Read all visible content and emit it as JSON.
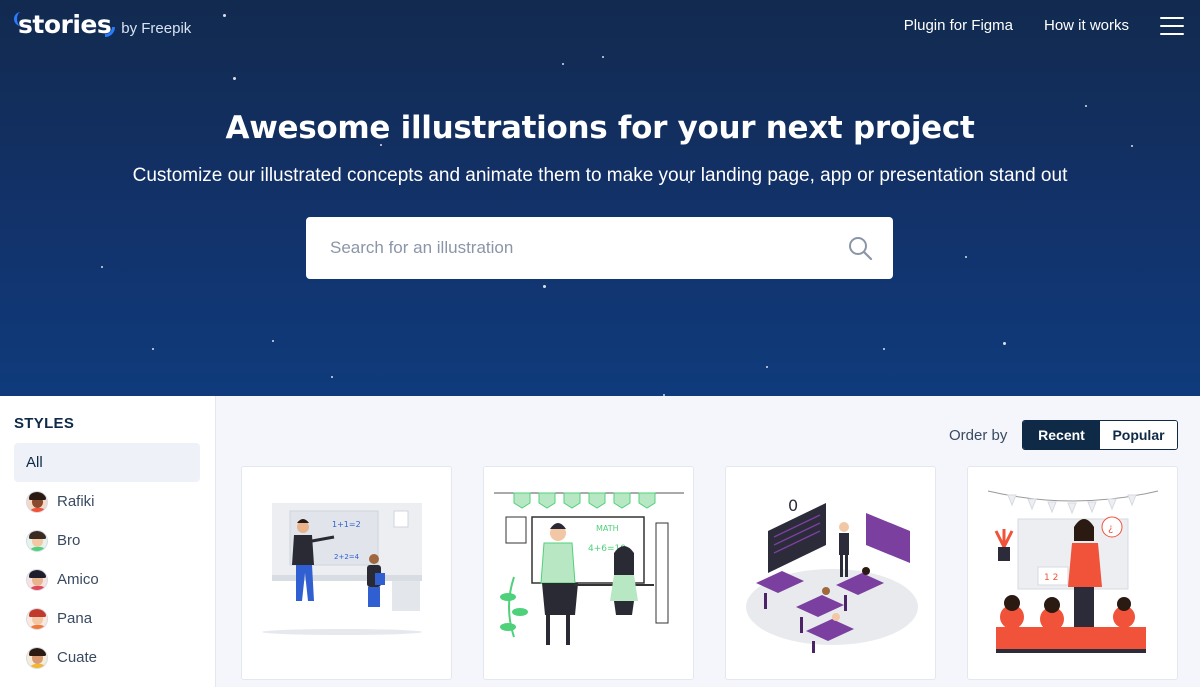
{
  "header": {
    "logo_text": "stories",
    "logo_by": "by Freepik",
    "nav": [
      {
        "label": "Plugin for Figma"
      },
      {
        "label": "How it works"
      }
    ],
    "menu_icon": "hamburger-icon"
  },
  "hero": {
    "title": "Awesome illustrations for your next project",
    "subtitle": "Customize our illustrated concepts and animate them to make your landing page, app or presentation stand out",
    "search": {
      "placeholder": "Search for an illustration",
      "value": "",
      "icon": "search-icon"
    }
  },
  "sidebar": {
    "heading": "STYLES",
    "items": [
      {
        "label": "All",
        "active": true
      },
      {
        "label": "Rafiki",
        "avatar": "rafiki-avatar-icon"
      },
      {
        "label": "Bro",
        "avatar": "bro-avatar-icon"
      },
      {
        "label": "Amico",
        "avatar": "amico-avatar-icon"
      },
      {
        "label": "Pana",
        "avatar": "pana-avatar-icon"
      },
      {
        "label": "Cuate",
        "avatar": "cuate-avatar-icon"
      }
    ]
  },
  "main": {
    "order_label": "Order by",
    "order_options": [
      {
        "label": "Recent",
        "active": true
      },
      {
        "label": "Popular",
        "active": false
      }
    ],
    "cards": [
      {
        "name": "teacher-illustration-blue",
        "accent": "#2f5fd0",
        "board_text": "1+1=2",
        "board_text2": "2+2=4"
      },
      {
        "name": "math-class-illustration-green",
        "accent": "#4fd07a",
        "board_text": "MATH",
        "board_text2": "4+6=10"
      },
      {
        "name": "classroom-isometric-illustration-purple",
        "accent": "#7b3fa0"
      },
      {
        "name": "teacher-kids-illustration-red",
        "accent": "#f0523a",
        "board_text": "1 2"
      }
    ]
  },
  "colors": {
    "hero_top": "#122a4f",
    "hero_bottom": "#0f3b7c",
    "brand_blue": "#2b7bff",
    "navy": "#0e2a47"
  }
}
